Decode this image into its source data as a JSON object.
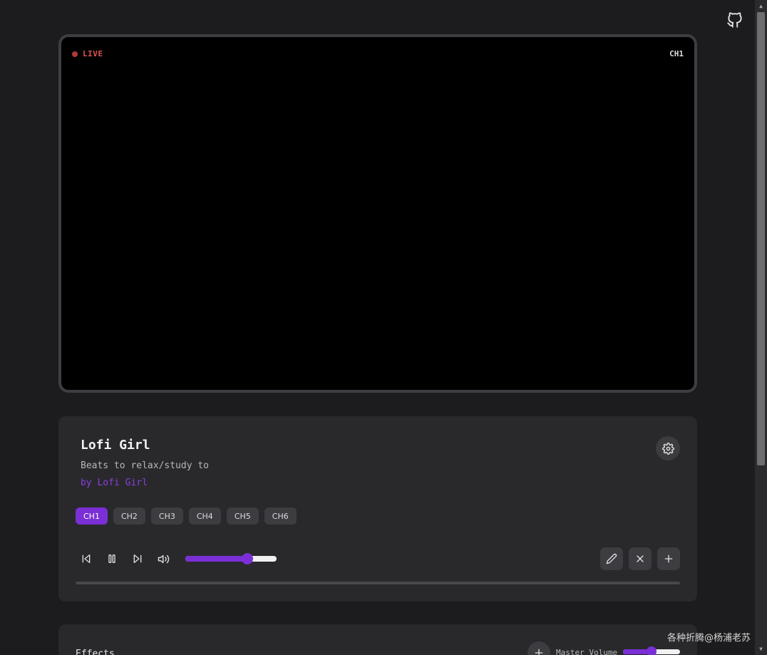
{
  "video": {
    "live_label": "LIVE",
    "channel_indicator": "CH1"
  },
  "player": {
    "title": "Lofi Girl",
    "subtitle": "Beats to relax/study to",
    "author": "by Lofi Girl",
    "channels": [
      {
        "label": "CH1",
        "active": true
      },
      {
        "label": "CH2",
        "active": false
      },
      {
        "label": "CH3",
        "active": false
      },
      {
        "label": "CH4",
        "active": false
      },
      {
        "label": "CH5",
        "active": false
      },
      {
        "label": "CH6",
        "active": false
      }
    ],
    "volume_fraction": 0.68,
    "progress_fraction": 0.0
  },
  "effects": {
    "title": "Effects",
    "master_volume_label": "Master Volume",
    "master_volume_fraction": 0.5
  },
  "watermark": "各种折腾@杨浦老苏",
  "icons": {
    "github": "github-icon",
    "settings": "gear-icon",
    "prev": "skip-back-icon",
    "pause": "pause-icon",
    "next": "skip-forward-icon",
    "volume": "volume-icon",
    "edit": "pencil-icon",
    "close": "close-icon",
    "add": "plus-icon"
  },
  "colors": {
    "accent": "#7b2fd6",
    "live": "#d9534f",
    "background": "#1c1c1e",
    "card": "#29292c"
  }
}
